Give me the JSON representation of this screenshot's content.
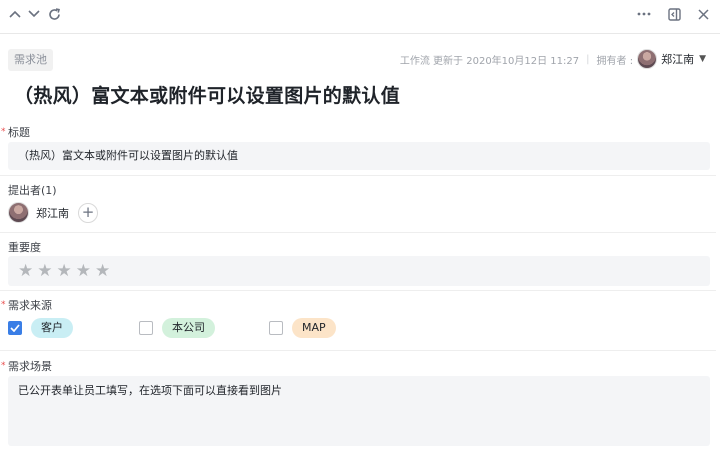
{
  "toolbar": {
    "icons": [
      "chevron-up-icon",
      "chevron-down-icon",
      "refresh-icon",
      "more-icon",
      "collapse-panel-icon",
      "close-icon"
    ]
  },
  "header": {
    "tag": "需求池",
    "workflow_text": "工作流 更新于 2020年10月12日 11:27",
    "owner_label": "拥有者 :",
    "owner_name": "郑江南"
  },
  "title": "（热风）富文本或附件可以设置图片的默认值",
  "fields": {
    "title_field": {
      "label": "标题",
      "required": "*",
      "value": "（热风）富文本或附件可以设置图片的默认值"
    },
    "submitter": {
      "label": "提出者(1)",
      "name": "郑江南",
      "add_symbol": "+"
    },
    "importance": {
      "label": "重要度",
      "stars_total": 5,
      "stars_filled": 0
    },
    "source": {
      "label": "需求来源",
      "required": "*",
      "options": [
        {
          "label": "客户",
          "checked": true,
          "color": "#c9eef4"
        },
        {
          "label": "本公司",
          "checked": false,
          "color": "#d3f1dc"
        },
        {
          "label": "MAP",
          "checked": false,
          "color": "#fce4c8"
        }
      ]
    },
    "scenario": {
      "label": "需求场景",
      "required": "*",
      "value": "已公开表单让员工填写，在选项下面可以直接看到图片"
    }
  },
  "colors": {
    "accent": "#3a7ee6",
    "required": "#e84d4d"
  }
}
